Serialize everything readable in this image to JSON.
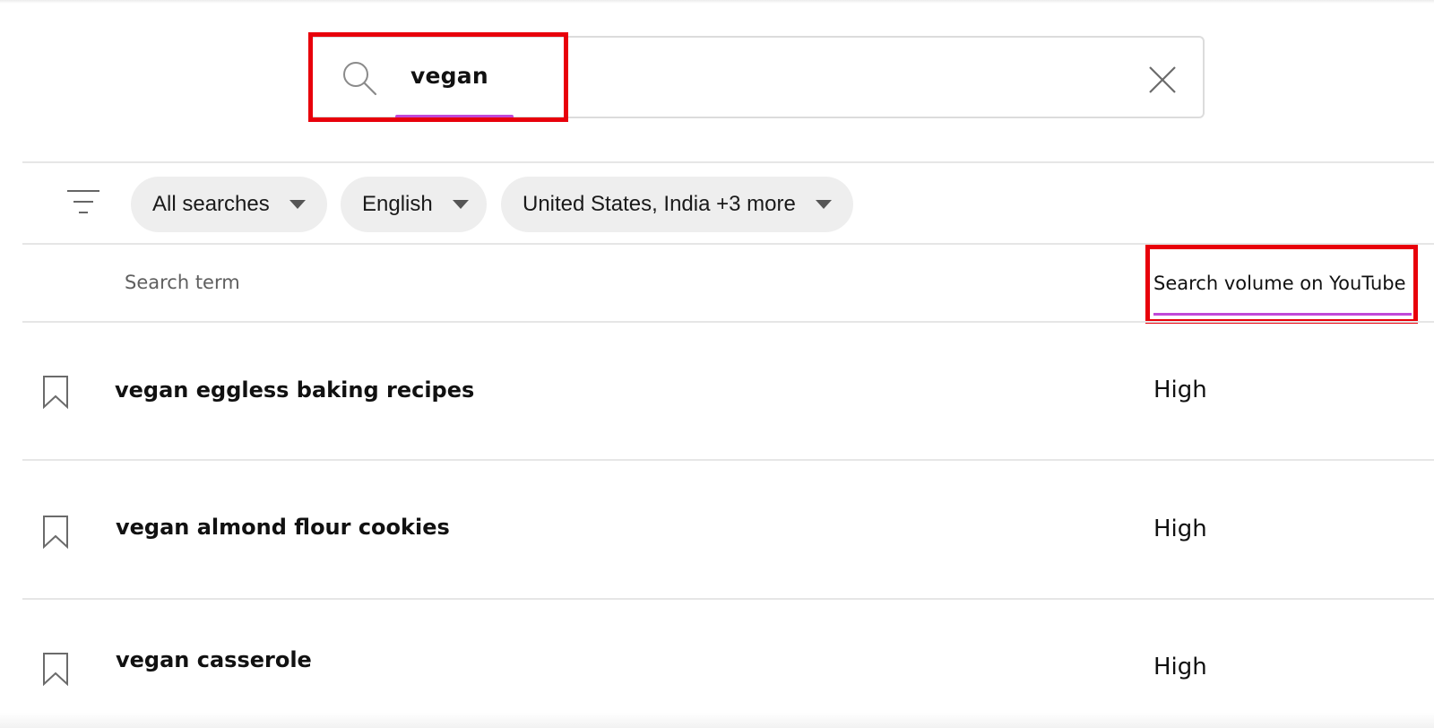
{
  "search": {
    "value": "vegan",
    "search_icon": "search-icon",
    "clear_icon": "close-icon"
  },
  "filters": {
    "filter_icon": "filter-list-icon",
    "chips": [
      {
        "label": "All searches"
      },
      {
        "label": "English"
      },
      {
        "label": "United States, India +3 more"
      }
    ]
  },
  "table": {
    "headers": {
      "term": "Search term",
      "volume": "Search volume on YouTube"
    },
    "rows": [
      {
        "term": "vegan eggless baking recipes",
        "volume": "High"
      },
      {
        "term": "vegan almond flour cookies",
        "volume": "High"
      },
      {
        "term": "vegan casserole",
        "volume": "High"
      }
    ]
  },
  "colors": {
    "highlight_box": "#e8000b",
    "underline_accent": "#c048d8",
    "chip_background": "#eeeeee"
  }
}
